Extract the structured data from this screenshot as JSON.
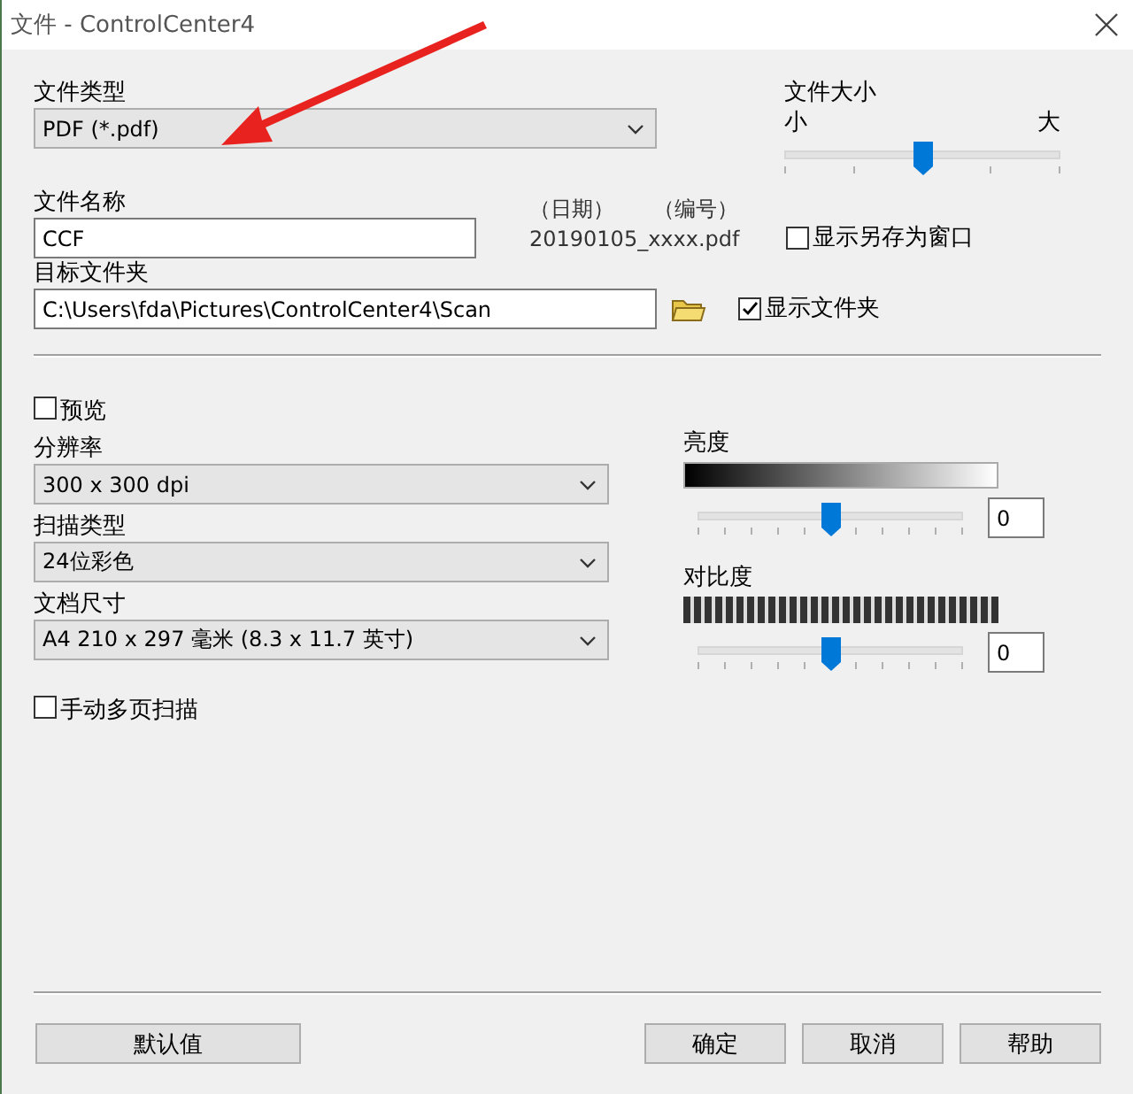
{
  "window": {
    "title": "文件 - ControlCenter4"
  },
  "file_type": {
    "label": "文件类型",
    "value": "PDF (*.pdf)"
  },
  "file_size": {
    "label": "文件大小",
    "min_label": "小",
    "max_label": "大",
    "level": 0.5
  },
  "file_name": {
    "label": "文件名称",
    "value": "CCF"
  },
  "name_hint": {
    "date": "（日期）",
    "number": "（编号）",
    "example": "20190105_xxxx.pdf"
  },
  "show_save_as": {
    "label": "显示另存为窗口",
    "checked": false
  },
  "destination": {
    "label": "目标文件夹",
    "value": "C:\\Users\\fda\\Pictures\\ControlCenter4\\Scan"
  },
  "show_folder": {
    "label": "显示文件夹",
    "checked": true
  },
  "preview": {
    "label": "预览",
    "checked": false
  },
  "selects": [
    {
      "label": "分辨率",
      "value": "300 x 300 dpi"
    },
    {
      "label": "扫描类型",
      "value": "24位彩色"
    },
    {
      "label": "文档尺寸",
      "value": "A4 210 x 297 毫米 (8.3 x 11.7 英寸)"
    }
  ],
  "manual_multipage": {
    "label": "手动多页扫描",
    "checked": false
  },
  "adjustments": [
    {
      "label": "亮度",
      "kind": "gradient",
      "level": 0.5,
      "value": "0"
    },
    {
      "label": "对比度",
      "kind": "stripes",
      "level": 0.5,
      "value": "0"
    }
  ],
  "buttons": [
    {
      "label": "默认值"
    },
    {
      "label": "确定"
    },
    {
      "label": "取消"
    },
    {
      "label": "帮助"
    }
  ]
}
